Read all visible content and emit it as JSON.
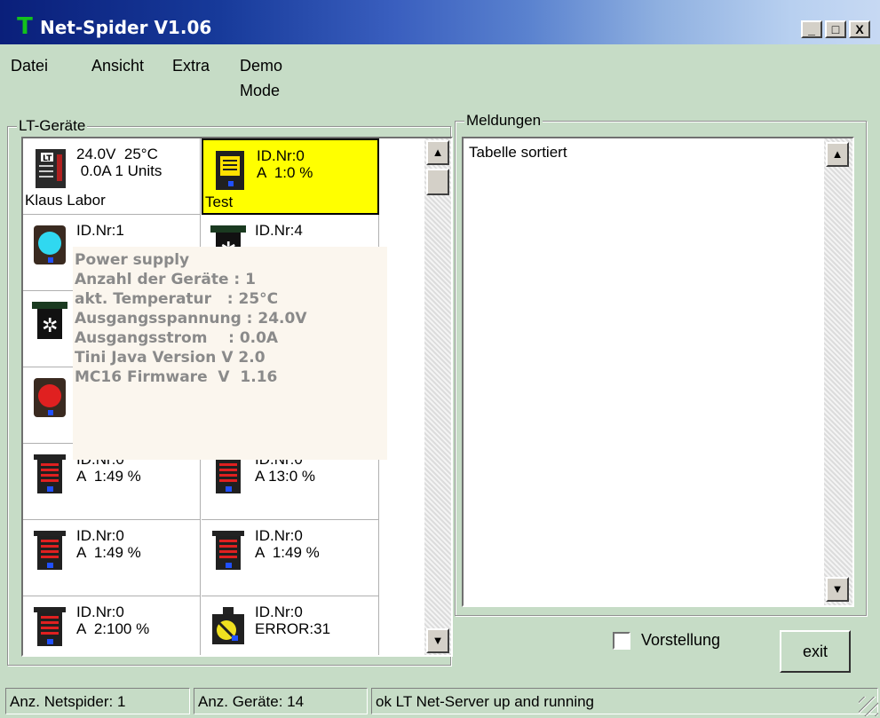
{
  "window": {
    "title": "Net-Spider V1.06",
    "app_icon_glyph": "T",
    "buttons": {
      "minimize": "_",
      "maximize": "□",
      "close": "X"
    }
  },
  "menu": [
    "Datei",
    "Ansicht",
    "Extra",
    "Demo Mode"
  ],
  "devices_group": {
    "label": "LT-Geräte",
    "cells": [
      {
        "icon": "lt-controller-icon",
        "line1": "24.0V  25°C",
        "line2": " 0.0A 1 Units",
        "name": "Klaus Labor",
        "selected": false
      },
      {
        "icon": "yellow-module-icon",
        "line1": "ID.Nr:0",
        "line2": "A  1:0 %",
        "name": "Test",
        "selected": true
      },
      {
        "icon": "cyan-lamp-module-icon",
        "line1": "ID.Nr:1",
        "line2": "",
        "name": "",
        "selected": false
      },
      {
        "icon": "fan-module-icon",
        "line1": "ID.Nr:4",
        "line2": "",
        "name": "",
        "selected": false
      },
      {
        "icon": "fan-module-icon",
        "line1": "",
        "line2": "",
        "name": "",
        "selected": false
      },
      {
        "icon": "",
        "line1": "",
        "line2": "",
        "name": "",
        "selected": false
      },
      {
        "icon": "red-lamp-module-icon",
        "line1": "",
        "line2": "",
        "name": "",
        "selected": false
      },
      {
        "icon": "",
        "line1": "",
        "line2": "",
        "name": "",
        "selected": false
      },
      {
        "icon": "red-module-icon",
        "line1": "ID.Nr:0",
        "line2": "A  1:49 %",
        "name": "",
        "selected": false
      },
      {
        "icon": "red-module-icon",
        "line1": "ID.Nr:0",
        "line2": "A 13:0 %",
        "name": "",
        "selected": false
      },
      {
        "icon": "red-module-icon",
        "line1": "ID.Nr:0",
        "line2": "A  1:49 %",
        "name": "",
        "selected": false
      },
      {
        "icon": "red-module-icon",
        "line1": "ID.Nr:0",
        "line2": "A  1:49 %",
        "name": "",
        "selected": false
      },
      {
        "icon": "red-module-icon",
        "line1": "ID.Nr:0",
        "line2": "A  2:100 %",
        "name": "",
        "selected": false
      },
      {
        "icon": "error-module-icon",
        "line1": "ID.Nr:0",
        "line2": "ERROR:31",
        "name": "",
        "selected": false
      }
    ]
  },
  "tooltip": {
    "lines": [
      "Power supply",
      "Anzahl der Geräte : 1",
      "akt. Temperatur   : 25°C",
      "Ausgangsspannung : 24.0V",
      "Ausgangsstrom    : 0.0A",
      "Tini Java Version V 2.0",
      "MC16 Firmware  V  1.16"
    ]
  },
  "messages_group": {
    "label": "Meldungen",
    "text": "Tabelle sortiert"
  },
  "controls": {
    "checkbox_label": "Vorstellung",
    "checkbox_checked": false,
    "exit_label": "exit"
  },
  "statusbar": {
    "panels": [
      "Anz. Netspider: 1",
      "Anz. Geräte: 14",
      "ok LT Net-Server up and running"
    ]
  },
  "colors": {
    "window_bg": "#c6dcc6",
    "selected_cell": "#ffff00",
    "tooltip_bg": "#fbf6ee",
    "tooltip_text": "#8a8a8a"
  }
}
